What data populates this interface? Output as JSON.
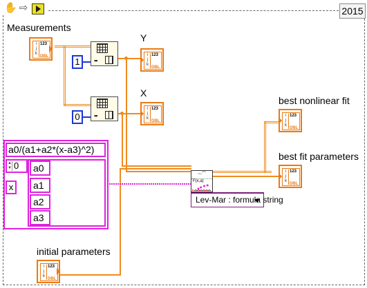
{
  "header": {
    "year": "2015",
    "toolbar_icons": [
      "hand-icon",
      "arrow-icon",
      "run-icon"
    ]
  },
  "labels": {
    "measurements": "Measurements",
    "y": "Y",
    "x": "X",
    "best_nonlinear_fit": "best nonlinear fit",
    "best_fit_parameters": "best fit parameters",
    "initial_parameters": "initial parameters"
  },
  "constants": {
    "index_y": "1",
    "index_x": "0"
  },
  "model": {
    "formula": "a0/(a1+a2*(x-a3)^2)",
    "array_index": "0",
    "independent_variable": "x",
    "parameters": [
      "a0",
      "a1",
      "a2",
      "a3"
    ]
  },
  "fit": {
    "method_selected": "Lev-Mar : formula string"
  },
  "terminal_text": {
    "numeric": "123",
    "type": "DBL"
  },
  "colors": {
    "wire_dbl": "#f08a1c",
    "cluster_string": "#e020e0",
    "constant_border": "#1a36d6"
  }
}
